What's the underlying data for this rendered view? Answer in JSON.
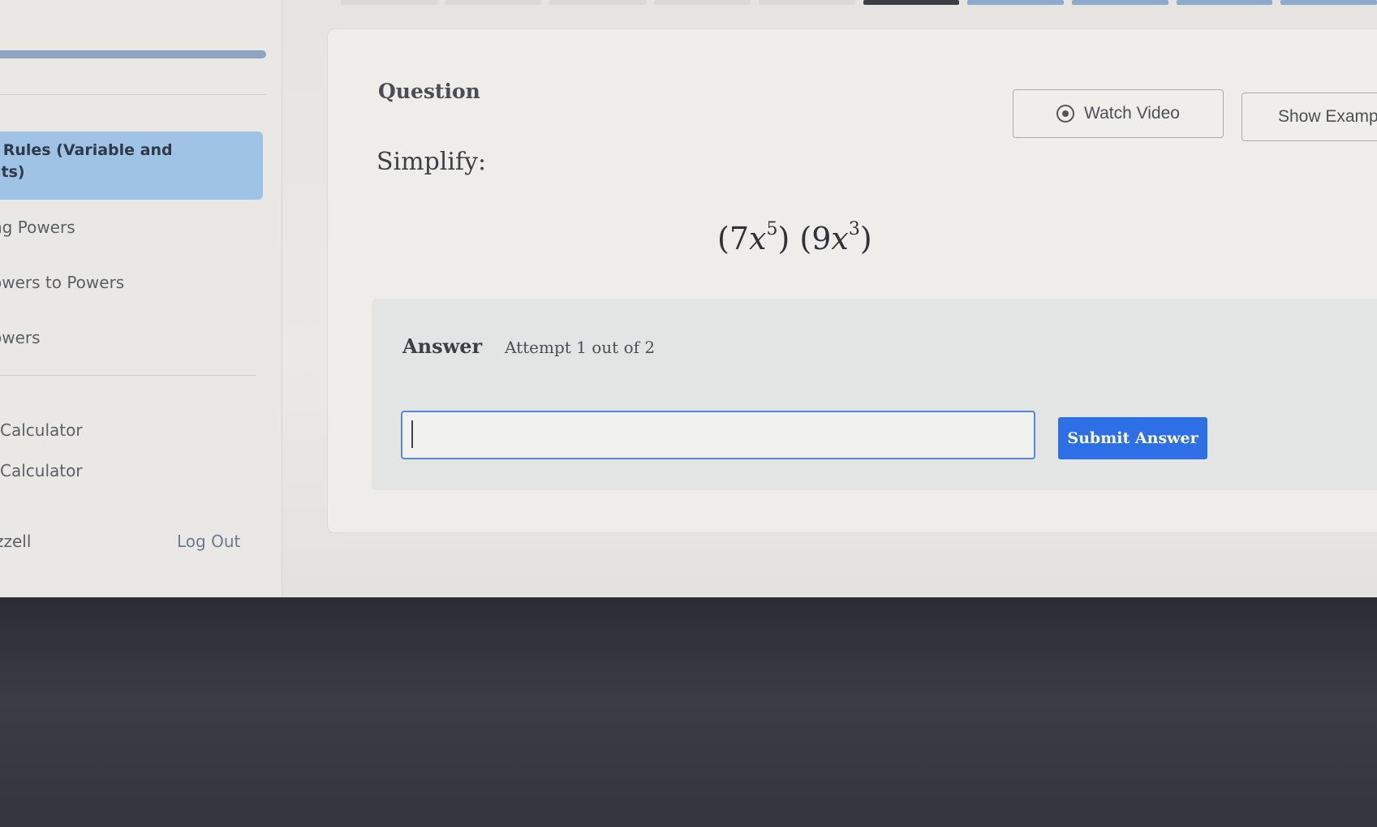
{
  "sidebar": {
    "active_item_line1": "t Rules (Variable and",
    "active_item_line2": "nts)",
    "items": [
      {
        "label": "ng Powers"
      },
      {
        "label": "owers to Powers"
      },
      {
        "label": "owers"
      },
      {
        "label": "Calculator"
      },
      {
        "label": "Calculator"
      }
    ],
    "username": "zzell",
    "logout_label": "Log Out"
  },
  "question": {
    "title": "Question",
    "watch_video_label": "Watch Video",
    "show_example_label": "Show Examp",
    "prompt": "Simplify:",
    "expression": {
      "term1_coef": "7",
      "term1_var": "x",
      "term1_exp": "5",
      "term2_coef": "9",
      "term2_var": "x",
      "term2_exp": "3"
    }
  },
  "answer": {
    "label": "Answer",
    "attempt_text": "Attempt 1 out of 2",
    "input_value": "",
    "submit_label": "Submit Answer"
  },
  "colors": {
    "accent": "#2f6fe6",
    "sidebar_active": "#9fc3e4",
    "input_border": "#5b86d6"
  }
}
